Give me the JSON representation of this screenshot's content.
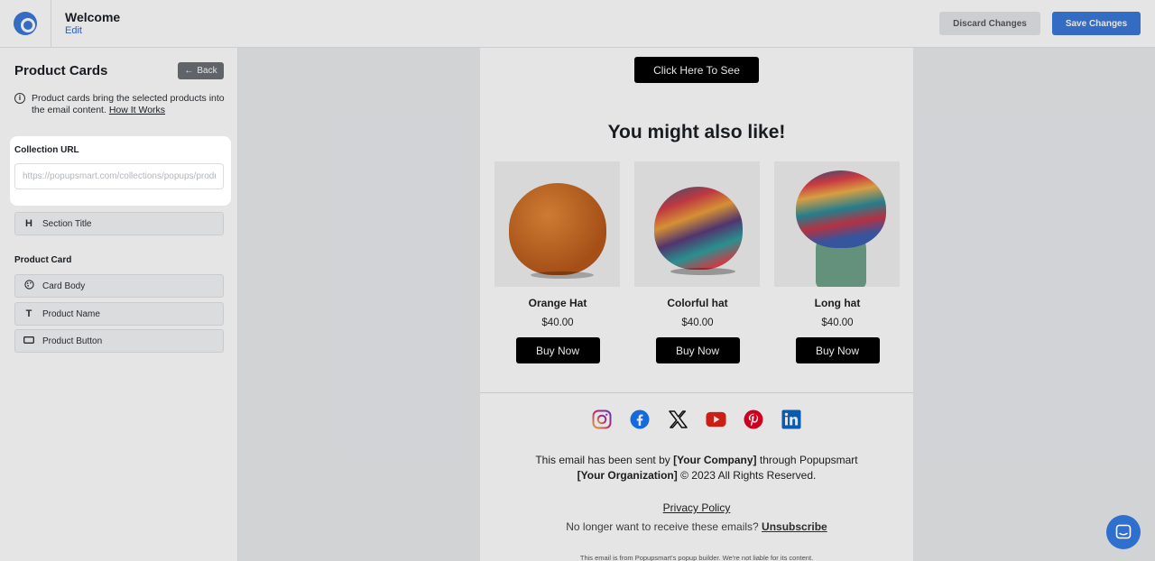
{
  "header": {
    "title": "Welcome",
    "edit_label": "Edit",
    "discard_label": "Discard Changes",
    "save_label": "Save Changes"
  },
  "sidebar": {
    "title": "Product Cards",
    "back_label": "Back",
    "info_text": "Product cards bring the selected products into the email content.",
    "info_link": "How It Works",
    "collection_url": {
      "label": "Collection URL",
      "placeholder": "https://popupsmart.com/collections/popups/products",
      "value": ""
    },
    "section_title_label": "Section Title",
    "product_card_group": "Product Card",
    "items": [
      {
        "label": "Card Body",
        "icon": "palette-icon"
      },
      {
        "label": "Product Name",
        "icon": "text-icon"
      },
      {
        "label": "Product Button",
        "icon": "button-icon"
      }
    ]
  },
  "email": {
    "cta_label": "Click Here To See",
    "section_heading": "You might also like!",
    "products": [
      {
        "name": "Orange Hat",
        "price": "$40.00",
        "button": "Buy Now"
      },
      {
        "name": "Colorful hat",
        "price": "$40.00",
        "button": "Buy Now"
      },
      {
        "name": "Long hat",
        "price": "$40.00",
        "button": "Buy Now"
      }
    ],
    "socials": [
      "instagram-icon",
      "facebook-icon",
      "x-icon",
      "youtube-icon",
      "pinterest-icon",
      "linkedin-icon"
    ],
    "footer": {
      "sent_prefix": "This email has been sent by",
      "company": "[Your Company]",
      "sent_suffix": "through Popupsmart",
      "organization": "[Your Organization]",
      "rights": "© 2023 All Rights Reserved.",
      "privacy": "Privacy Policy",
      "unsub_prefix": "No longer want to receive these emails?",
      "unsub": "Unsubscribe",
      "fine_print": "This email is from Popupsmart's popup builder. We're not liable for its content."
    }
  },
  "colors": {
    "brand": "#3a79db",
    "cta_bg": "#000000"
  }
}
